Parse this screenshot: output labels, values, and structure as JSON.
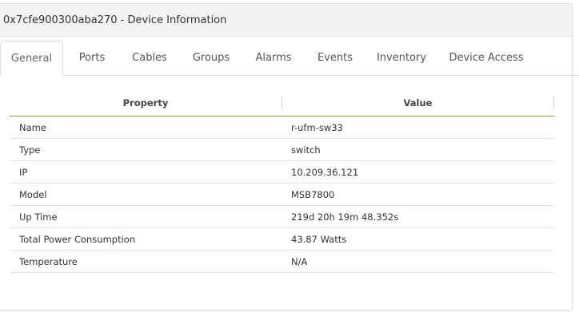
{
  "window": {
    "title": "0x7cfe900300aba270 - Device Information"
  },
  "tabs": [
    {
      "label": "General",
      "active": true
    },
    {
      "label": "Ports"
    },
    {
      "label": "Cables"
    },
    {
      "label": "Groups"
    },
    {
      "label": "Alarms"
    },
    {
      "label": "Events"
    },
    {
      "label": "Inventory"
    },
    {
      "label": "Device Access"
    }
  ],
  "table": {
    "headers": {
      "property": "Property",
      "value": "Value"
    },
    "rows": [
      {
        "property": "Name",
        "value": "r-ufm-sw33"
      },
      {
        "property": "Type",
        "value": "switch"
      },
      {
        "property": "IP",
        "value": "10.209.36.121"
      },
      {
        "property": "Model",
        "value": "MSB7800"
      },
      {
        "property": "Up Time",
        "value": "219d 20h 19m 48.352s"
      },
      {
        "property": "Total Power Consumption",
        "value": "43.87 Watts"
      },
      {
        "property": "Temperature",
        "value": "N/A"
      }
    ]
  },
  "colors": {
    "header_underline": "#8a9a3a"
  }
}
